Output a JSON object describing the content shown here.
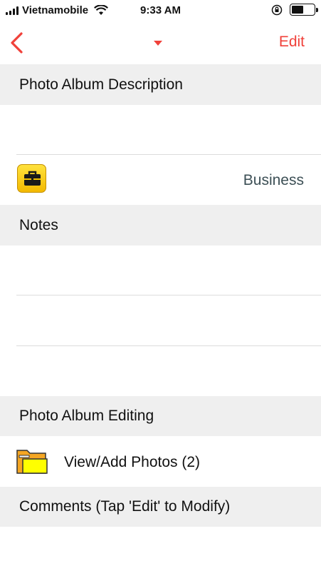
{
  "status_bar": {
    "carrier": "Vietnamobile",
    "time": "9:33 AM",
    "icons": [
      "signal-icon",
      "wifi-icon",
      "orientation-lock-icon",
      "battery-icon"
    ]
  },
  "nav": {
    "back_icon": "chevron-left-icon",
    "title_icon": "caret-down-icon",
    "edit_label": "Edit",
    "accent_color": "#f0413a"
  },
  "sections": {
    "description_header": "Photo Album Description",
    "category_value": "Business",
    "category_icon": "briefcase-icon",
    "notes_header": "Notes",
    "editing_header": "Photo Album Editing",
    "view_add_photos": "View/Add Photos (2)",
    "folder_icon": "folder-icon",
    "comments_header": "Comments (Tap 'Edit' to Modify)"
  }
}
